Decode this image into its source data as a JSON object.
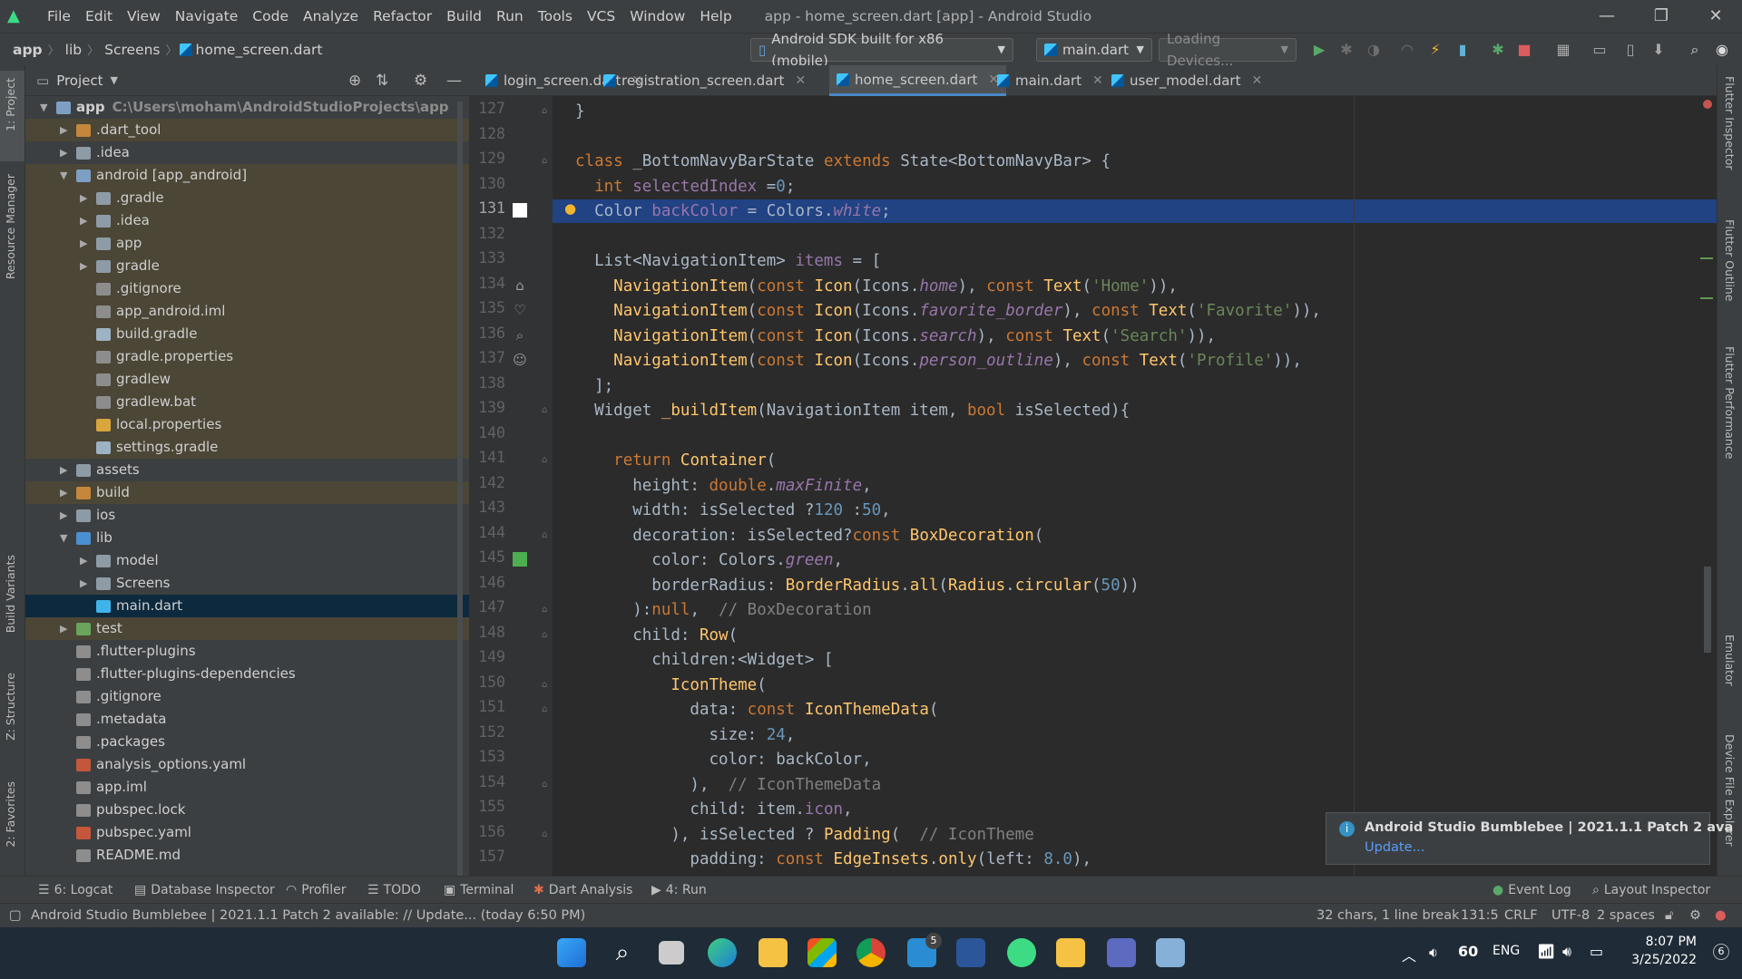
{
  "window": {
    "title": "app - home_screen.dart [app] - Android Studio",
    "menu": [
      "File",
      "Edit",
      "View",
      "Navigate",
      "Code",
      "Analyze",
      "Refactor",
      "Build",
      "Run",
      "Tools",
      "VCS",
      "Window",
      "Help"
    ],
    "minimize": "—",
    "restore": "❐",
    "close": "✕"
  },
  "breadcrumb": {
    "items": [
      "app",
      "lib",
      "Screens",
      "home_screen.dart"
    ]
  },
  "toolbar": {
    "device_select": "Android SDK built for x86 (mobile)",
    "run_config": "main.dart",
    "devices_loading": "Loading Devices..."
  },
  "project_panel": {
    "title": "Project",
    "tree": [
      {
        "label": "app",
        "path": "C:\\Users\\moham\\AndroidStudioProjects\\app",
        "depth": 0,
        "arrow": "▼",
        "type": "module"
      },
      {
        "label": ".dart_tool",
        "depth": 1,
        "arrow": "▶",
        "type": "folder-orange"
      },
      {
        "label": ".idea",
        "depth": 1,
        "arrow": "▶",
        "type": "folder-gray"
      },
      {
        "label": "android [app_android]",
        "depth": 1,
        "arrow": "▼",
        "type": "module"
      },
      {
        "label": ".gradle",
        "depth": 2,
        "arrow": "▶",
        "type": "folder-gray"
      },
      {
        "label": ".idea",
        "depth": 2,
        "arrow": "▶",
        "type": "folder-gray"
      },
      {
        "label": "app",
        "depth": 2,
        "arrow": "▶",
        "type": "folder-gray"
      },
      {
        "label": "gradle",
        "depth": 2,
        "arrow": "▶",
        "type": "folder-gray"
      },
      {
        "label": ".gitignore",
        "depth": 2,
        "arrow": "",
        "type": "file"
      },
      {
        "label": "app_android.iml",
        "depth": 2,
        "arrow": "",
        "type": "file"
      },
      {
        "label": "build.gradle",
        "depth": 2,
        "arrow": "",
        "type": "gradle"
      },
      {
        "label": "gradle.properties",
        "depth": 2,
        "arrow": "",
        "type": "file"
      },
      {
        "label": "gradlew",
        "depth": 2,
        "arrow": "",
        "type": "file"
      },
      {
        "label": "gradlew.bat",
        "depth": 2,
        "arrow": "",
        "type": "file"
      },
      {
        "label": "local.properties",
        "depth": 2,
        "arrow": "",
        "type": "chart"
      },
      {
        "label": "settings.gradle",
        "depth": 2,
        "arrow": "",
        "type": "gradle"
      },
      {
        "label": "assets",
        "depth": 1,
        "arrow": "▶",
        "type": "folder-gray"
      },
      {
        "label": "build",
        "depth": 1,
        "arrow": "▶",
        "type": "folder-orange"
      },
      {
        "label": "ios",
        "depth": 1,
        "arrow": "▶",
        "type": "folder-gray"
      },
      {
        "label": "lib",
        "depth": 1,
        "arrow": "▼",
        "type": "folder-blue"
      },
      {
        "label": "model",
        "depth": 2,
        "arrow": "▶",
        "type": "folder-gray"
      },
      {
        "label": "Screens",
        "depth": 2,
        "arrow": "▶",
        "type": "folder-gray"
      },
      {
        "label": "main.dart",
        "depth": 2,
        "arrow": "",
        "type": "dart"
      },
      {
        "label": "test",
        "depth": 1,
        "arrow": "▶",
        "type": "folder-green"
      },
      {
        "label": ".flutter-plugins",
        "depth": 1,
        "arrow": "",
        "type": "file"
      },
      {
        "label": ".flutter-plugins-dependencies",
        "depth": 1,
        "arrow": "",
        "type": "file"
      },
      {
        "label": ".gitignore",
        "depth": 1,
        "arrow": "",
        "type": "file"
      },
      {
        "label": ".metadata",
        "depth": 1,
        "arrow": "",
        "type": "file"
      },
      {
        "label": ".packages",
        "depth": 1,
        "arrow": "",
        "type": "file"
      },
      {
        "label": "analysis_options.yaml",
        "depth": 1,
        "arrow": "",
        "type": "yaml"
      },
      {
        "label": "app.iml",
        "depth": 1,
        "arrow": "",
        "type": "file"
      },
      {
        "label": "pubspec.lock",
        "depth": 1,
        "arrow": "",
        "type": "file"
      },
      {
        "label": "pubspec.yaml",
        "depth": 1,
        "arrow": "",
        "type": "yaml"
      },
      {
        "label": "README.md",
        "depth": 1,
        "arrow": "",
        "type": "file"
      }
    ]
  },
  "tabs": [
    "login_screen.dart",
    "registration_screen.dart",
    "home_screen.dart",
    "main.dart",
    "user_model.dart"
  ],
  "active_tab": "home_screen.dart",
  "editor": {
    "lines": [
      {
        "n": "127",
        "html": "}"
      },
      {
        "n": "128",
        "html": ""
      },
      {
        "n": "129",
        "html": "<span class='k'>class</span> _BottomNavyBarState <span class='k'>extends</span> State&lt;BottomNavyBar&gt; {"
      },
      {
        "n": "130",
        "html": "  <span class='k'>int</span> <span class='v'>selectedIndex</span> =<span class='n'>0</span>;"
      },
      {
        "n": "131",
        "html": "  Color <span class='v'>backColor</span> = Colors.<span class='it'>white</span>;"
      },
      {
        "n": "132",
        "html": ""
      },
      {
        "n": "133",
        "html": "  List&lt;NavigationItem&gt; <span class='v'>items</span> = ["
      },
      {
        "n": "134",
        "html": "    <span class='cls'>NavigationItem</span>(<span class='k'>const</span> <span class='cls'>Icon</span>(Icons.<span class='it'>home</span>), <span class='k'>const</span> <span class='cls'>Text</span>(<span class='s'>'Home'</span>)),"
      },
      {
        "n": "135",
        "html": "    <span class='cls'>NavigationItem</span>(<span class='k'>const</span> <span class='cls'>Icon</span>(Icons.<span class='it'>favorite_border</span>), <span class='k'>const</span> <span class='cls'>Text</span>(<span class='s'>'Favorite'</span>)),"
      },
      {
        "n": "136",
        "html": "    <span class='cls'>NavigationItem</span>(<span class='k'>const</span> <span class='cls'>Icon</span>(Icons.<span class='it'>search</span>), <span class='k'>const</span> <span class='cls'>Text</span>(<span class='s'>'Search'</span>)),"
      },
      {
        "n": "137",
        "html": "    <span class='cls'>NavigationItem</span>(<span class='k'>const</span> <span class='cls'>Icon</span>(Icons.<span class='it'>person_outline</span>), <span class='k'>const</span> <span class='cls'>Text</span>(<span class='s'>'Profile'</span>)),"
      },
      {
        "n": "138",
        "html": "  ];"
      },
      {
        "n": "139",
        "html": "  Widget <span class='cls'>_buildItem</span>(NavigationItem item, <span class='k'>bool</span> isSelected){"
      },
      {
        "n": "140",
        "html": ""
      },
      {
        "n": "141",
        "html": "    <span class='k'>return</span> <span class='cls'>Container</span>("
      },
      {
        "n": "142",
        "html": "      height: <span class='k'>double</span>.<span class='it'>maxFinite</span>,"
      },
      {
        "n": "143",
        "html": "      width: isSelected ?<span class='n'>120</span> :<span class='n'>50</span>,"
      },
      {
        "n": "144",
        "html": "      decoration: isSelected?<span class='k'>const</span> <span class='cls'>BoxDecoration</span>("
      },
      {
        "n": "145",
        "html": "        color: Colors.<span class='it'>green</span>,"
      },
      {
        "n": "146",
        "html": "        borderRadius: <span class='cls'>BorderRadius</span>.<span class='cls'>all</span>(<span class='cls'>Radius</span>.<span class='cls'>circular</span>(<span class='n'>50</span>))"
      },
      {
        "n": "147",
        "html": "      ):<span class='k'>null</span>,  <span class='c'>// BoxDecoration</span>"
      },
      {
        "n": "148",
        "html": "      child: <span class='cls'>Row</span>("
      },
      {
        "n": "149",
        "html": "        children:&lt;Widget&gt; ["
      },
      {
        "n": "150",
        "html": "          <span class='cls'>IconTheme</span>("
      },
      {
        "n": "151",
        "html": "            data: <span class='k'>const</span> <span class='cls'>IconThemeData</span>("
      },
      {
        "n": "152",
        "html": "              size: <span class='n'>24</span>,"
      },
      {
        "n": "153",
        "html": "              color: backColor,"
      },
      {
        "n": "154",
        "html": "            ),  <span class='c'>// IconThemeData</span>"
      },
      {
        "n": "155",
        "html": "            child: item.<span class='v'>icon</span>,"
      },
      {
        "n": "156",
        "html": "          ), isSelected ? <span class='cls'>Padding</span>(  <span class='c'>// IconTheme</span>"
      },
      {
        "n": "157",
        "html": "            padding: <span class='k'>const</span> <span class='cls'>EdgeInsets</span>.<span class='cls'>only</span>(left: <span class='n'>8.0</span>),"
      }
    ]
  },
  "right_tools": [
    "Flutter Inspector",
    "Flutter Outline",
    "Flutter Performance",
    "Emulator",
    "Device File Explorer"
  ],
  "left_tools": [
    "1: Project",
    "Resource Manager",
    "Build Variants",
    "Z: Structure",
    "2: Favorites"
  ],
  "bottom_tools": [
    "6: Logcat",
    "Database Inspector",
    "Profiler",
    "TODO",
    "Terminal",
    "Dart Analysis",
    "4: Run"
  ],
  "bottom_right_tools": [
    "Event Log",
    "Layout Inspector"
  ],
  "status": {
    "message": "Android Studio Bumblebee | 2021.1.1 Patch 2 available: // Update... (today 6:50 PM)",
    "chars": "32 chars, 1 line break",
    "pos": "131:5",
    "line_sep": "CRLF",
    "encoding": "UTF-8",
    "indent": "2 spaces"
  },
  "notification": {
    "title": "Android Studio Bumblebee | 2021.1.1 Patch 2 ava",
    "link": "Update..."
  },
  "taskbar": {
    "time": "8:07 PM",
    "date": "3/25/2022",
    "lang": "ENG",
    "number": "60",
    "badge": "5",
    "notif_count": "6"
  }
}
